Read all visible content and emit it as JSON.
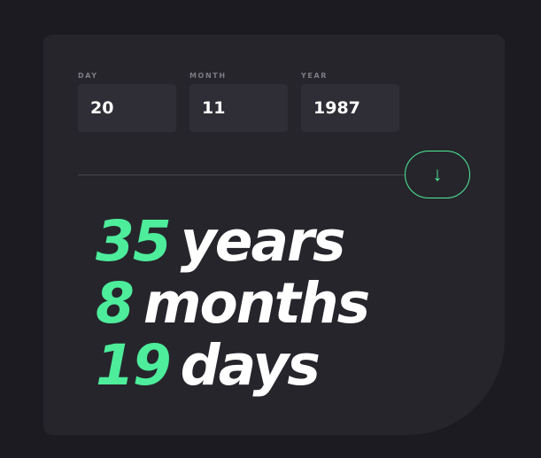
{
  "form": {
    "day": {
      "label": "DAY",
      "value": "20"
    },
    "month": {
      "label": "MONTH",
      "value": "11"
    },
    "year": {
      "label": "YEAR",
      "value": "1987"
    },
    "submit_icon": "↓"
  },
  "results": {
    "years": {
      "value": "35",
      "unit": "years"
    },
    "months": {
      "value": "8",
      "unit": "months"
    },
    "days": {
      "value": "19",
      "unit": "days"
    }
  },
  "colors": {
    "accent": "#4ded9b",
    "background": "#1c1b21",
    "card": "#26252c",
    "input": "#2f2e36",
    "label": "#7c7b82"
  },
  "icons": {
    "submit": "arrow-down-icon"
  }
}
